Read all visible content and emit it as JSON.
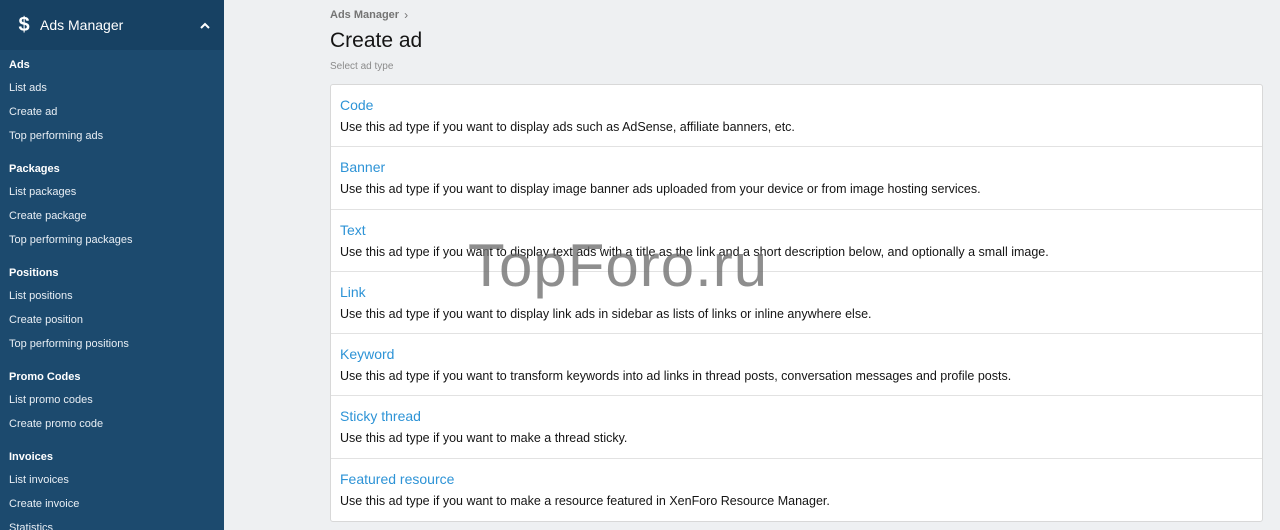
{
  "sidebar": {
    "header": {
      "title": "Ads Manager",
      "icon": "dollar-icon"
    },
    "sections": [
      {
        "title": "Ads",
        "items": [
          "List ads",
          "Create ad",
          "Top performing ads"
        ]
      },
      {
        "title": "Packages",
        "items": [
          "List packages",
          "Create package",
          "Top performing packages"
        ]
      },
      {
        "title": "Positions",
        "items": [
          "List positions",
          "Create position",
          "Top performing positions"
        ]
      },
      {
        "title": "Promo Codes",
        "items": [
          "List promo codes",
          "Create promo code"
        ]
      },
      {
        "title": "Invoices",
        "items": [
          "List invoices",
          "Create invoice",
          "Statistics"
        ]
      }
    ]
  },
  "breadcrumb": {
    "label": "Ads Manager",
    "separator": "›"
  },
  "page": {
    "title": "Create ad",
    "subtitle": "Select ad type"
  },
  "ad_types": [
    {
      "title": "Code",
      "description": "Use this ad type if you want to display ads such as AdSense, affiliate banners, etc."
    },
    {
      "title": "Banner",
      "description": "Use this ad type if you want to display image banner ads uploaded from your device or from image hosting services."
    },
    {
      "title": "Text",
      "description": "Use this ad type if you want to display text ads with a title as the link and a short description below, and optionally a small image."
    },
    {
      "title": "Link",
      "description": "Use this ad type if you want to display link ads in sidebar as lists of links or inline anywhere else."
    },
    {
      "title": "Keyword",
      "description": "Use this ad type if you want to transform keywords into ad links in thread posts, conversation messages and profile posts."
    },
    {
      "title": "Sticky thread",
      "description": "Use this ad type if you want to make a thread sticky."
    },
    {
      "title": "Featured resource",
      "description": "Use this ad type if you want to make a resource featured in XenForo Resource Manager."
    }
  ],
  "watermark": "TopForo.ru",
  "colors": {
    "sidebar": "#1c4a6e",
    "link": "#2d93d6",
    "background": "#eef0f2"
  }
}
